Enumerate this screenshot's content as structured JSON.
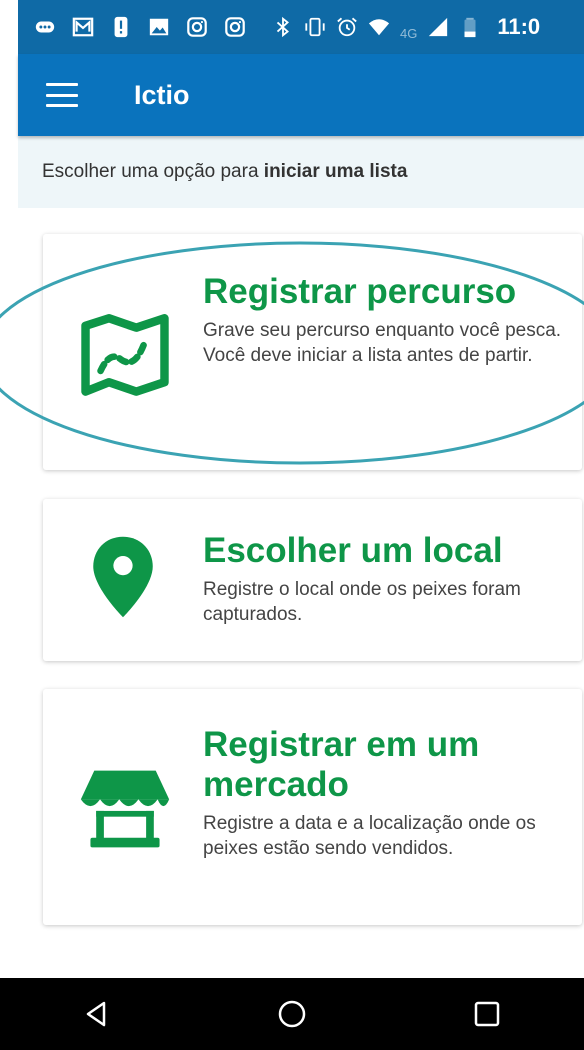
{
  "status_bar": {
    "network": "4G",
    "time": "11:0",
    "icons": [
      "more-icon",
      "gmail-icon",
      "alert-icon",
      "image-icon",
      "instagram-icon",
      "instagram-icon",
      "bluetooth-icon",
      "vibrate-icon",
      "alarm-icon",
      "wifi-icon",
      "signal-icon",
      "battery-icon"
    ]
  },
  "app_bar": {
    "title": "Ictio",
    "menu_icon": "hamburger-menu-icon"
  },
  "hint": {
    "prefix": "Escolher uma opção para ",
    "emphasis": "iniciar uma lista"
  },
  "options": [
    {
      "title": "Registrar percurso",
      "description": "Grave seu percurso enquanto você pesca. Você deve iniciar a lista antes de partir.",
      "icon": "map-route-icon"
    },
    {
      "title": "Escolher um local",
      "description": "Registre o local onde os peixes foram capturados.",
      "icon": "location-pin-icon"
    },
    {
      "title": "Registrar em um mercado",
      "description": "Registre a data e a localização onde os peixes estão sendo vendidos.",
      "icon": "market-stall-icon"
    }
  ],
  "nav_bar": {
    "buttons": [
      "back-icon",
      "home-icon",
      "recents-icon"
    ]
  },
  "colors": {
    "status_bar": "#0f6aa6",
    "app_bar": "#0a73bd",
    "accent_green": "#0e9648",
    "hint_background": "#eef6f9",
    "annotation_ring": "#3ba3b3"
  }
}
